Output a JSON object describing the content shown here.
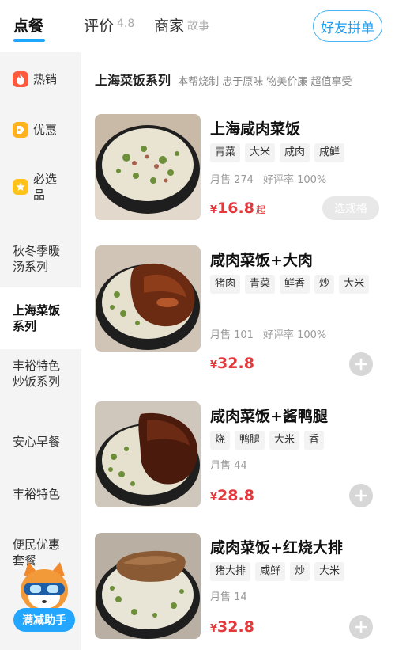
{
  "tabs": [
    {
      "label": "点餐",
      "sub": ""
    },
    {
      "label": "评价",
      "sub": "4.8"
    },
    {
      "label": "商家",
      "sub": "故事"
    }
  ],
  "friend_order_label": "好友拼单",
  "sidebar": {
    "items": [
      {
        "label": "热销",
        "icon": "fire-icon"
      },
      {
        "label": "优惠",
        "icon": "coupon-icon"
      },
      {
        "label": "必选品",
        "icon": "star-icon"
      },
      {
        "label": "秋冬季暖汤系列"
      },
      {
        "label": "上海菜饭系列"
      },
      {
        "label": "丰裕特色炒饭系列"
      },
      {
        "label": "安心早餐"
      },
      {
        "label": "丰裕特色"
      },
      {
        "label": "便民优惠套餐"
      }
    ],
    "helper_label": "满减助手"
  },
  "section": {
    "title": "上海菜饭系列",
    "desc": "本帮烧制 忠于原味 物美价廉 超值享受"
  },
  "items": [
    {
      "name": "上海咸肉菜饭",
      "tags": [
        "青菜",
        "大米",
        "咸肉",
        "咸鲜"
      ],
      "monthly_sales": "月售 274",
      "rating": "好评率 100%",
      "currency": "¥",
      "price": "16.8",
      "price_suffix": "起",
      "action": "选规格"
    },
    {
      "name": "咸肉菜饭+大肉",
      "tags": [
        "猪肉",
        "青菜",
        "鲜香",
        "炒",
        "大米"
      ],
      "monthly_sales": "月售 101",
      "rating": "好评率 100%",
      "currency": "¥",
      "price": "32.8",
      "price_suffix": "",
      "action": "add"
    },
    {
      "name": "咸肉菜饭+酱鸭腿",
      "tags": [
        "烧",
        "鸭腿",
        "大米",
        "香"
      ],
      "monthly_sales": "月售 44",
      "rating": "",
      "currency": "¥",
      "price": "28.8",
      "price_suffix": "",
      "action": "add"
    },
    {
      "name": "咸肉菜饭+红烧大排",
      "tags": [
        "猪大排",
        "咸鲜",
        "炒",
        "大米"
      ],
      "monthly_sales": "月售 14",
      "rating": "",
      "currency": "¥",
      "price": "32.8",
      "price_suffix": "",
      "action": "add"
    }
  ],
  "colors": {
    "accent": "#1da7ff",
    "price": "#e4393c",
    "sidebar_bg": "#f4f4f4"
  }
}
